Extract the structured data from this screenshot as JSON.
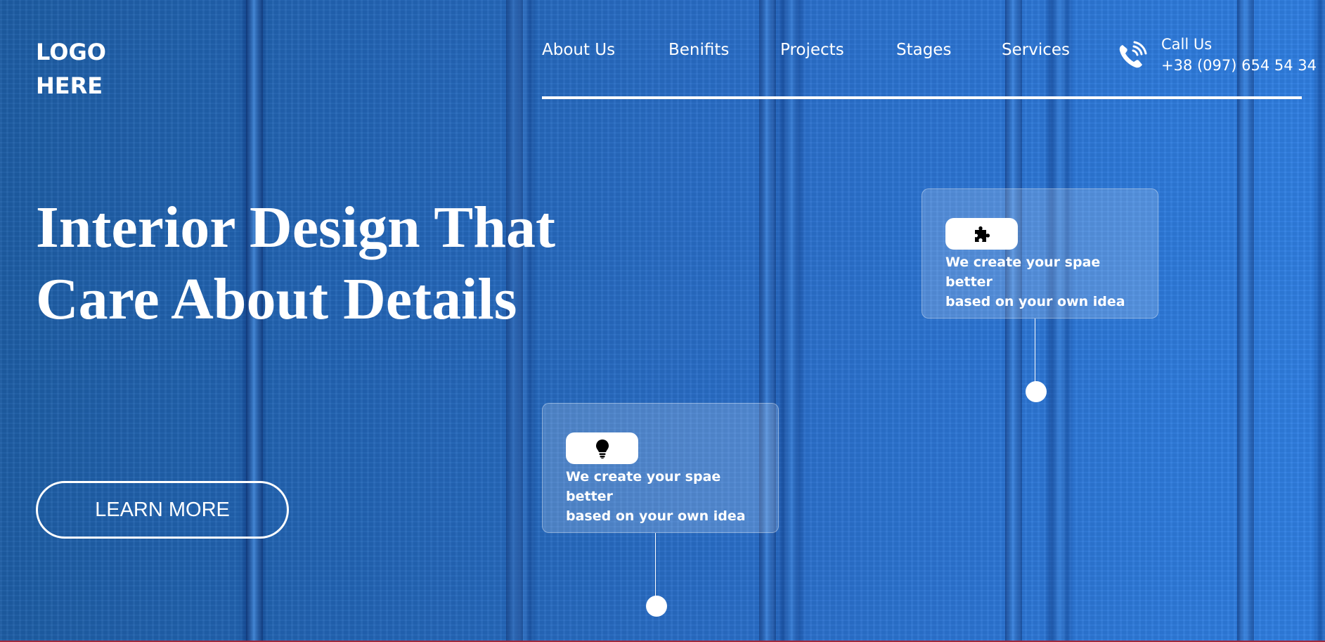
{
  "logo": {
    "line1": "LOGO",
    "line2": "HERE"
  },
  "nav": {
    "items": [
      {
        "label": "About Us"
      },
      {
        "label": "Benifits"
      },
      {
        "label": "Projects"
      },
      {
        "label": "Stages"
      },
      {
        "label": "Services"
      }
    ]
  },
  "contact": {
    "icon": "phone-call-icon",
    "label": "Call Us",
    "phone": "+38 (097) 654 54 34"
  },
  "hero": {
    "headline_line1": "Interior Design That",
    "headline_line2": "Care About Details",
    "cta_label": "LEARN MORE"
  },
  "cards": [
    {
      "icon": "puzzle-piece-icon",
      "text_line1": "We create your spae better",
      "text_line2": "based on your own idea"
    },
    {
      "icon": "lightbulb-icon",
      "text_line1": "We create your spae better",
      "text_line2": "based on your own idea"
    }
  ],
  "colors": {
    "background_blue": "#2a70cc",
    "text": "#ffffff",
    "bottom_rule": "#a0283c"
  }
}
